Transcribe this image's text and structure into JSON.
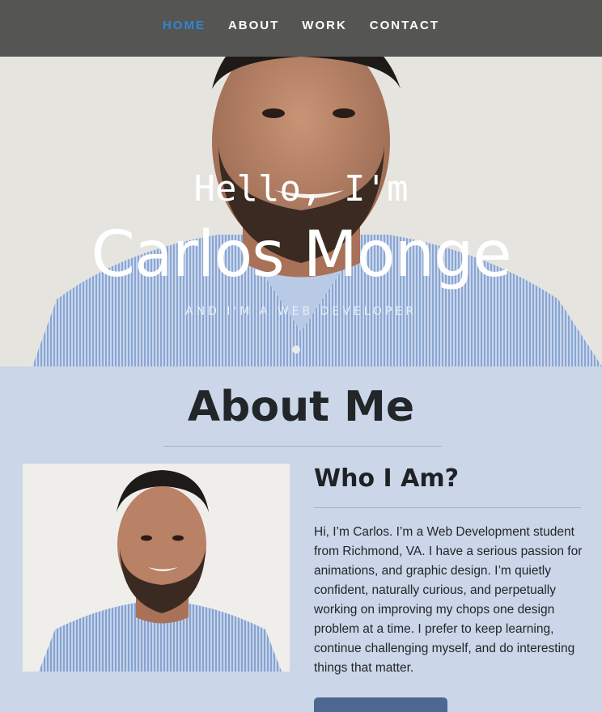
{
  "nav": {
    "items": [
      {
        "label": "HOME",
        "active": true
      },
      {
        "label": "ABOUT",
        "active": false
      },
      {
        "label": "WORK",
        "active": false
      },
      {
        "label": "CONTACT",
        "active": false
      }
    ]
  },
  "hero": {
    "greeting": "Hello, I'm",
    "name": "Carlos Monge",
    "tagline": "AND I'M A WEB DEVELOPER"
  },
  "about": {
    "title": "About Me",
    "subtitle": "Who I Am?",
    "bio": "Hi, I’m Carlos. I’m a Web Development student from Richmond, VA. I have a serious passion for animations, and graphic design. I’m quietly confident, naturally curious, and perpetually working on improving my chops one design problem at a time. I prefer to keep learning, continue challenging myself, and do interesting things that matter.",
    "button_label": ""
  },
  "colors": {
    "nav_bg": "#555553",
    "nav_active": "#2e86d6",
    "page_bg": "#cbd6e8",
    "button_bg": "#4c6890"
  }
}
